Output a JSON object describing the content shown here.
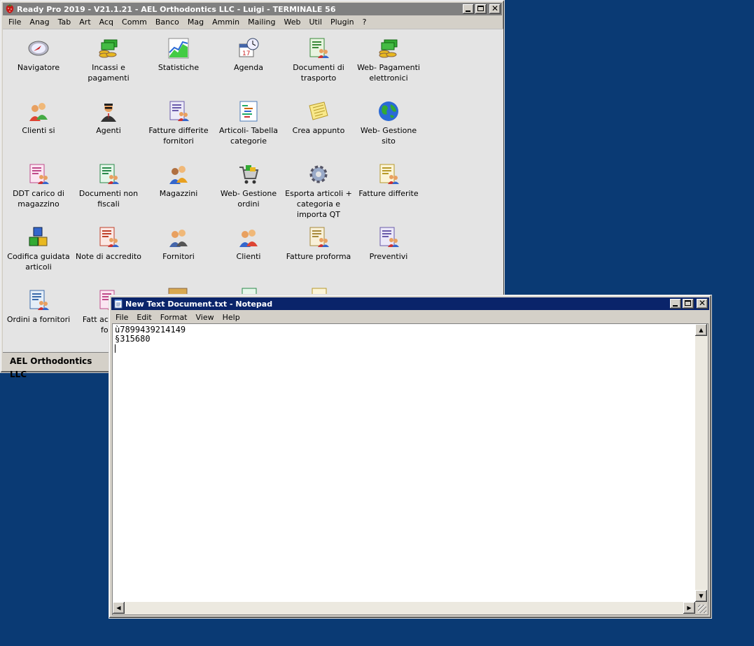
{
  "readypro": {
    "title": "Ready Pro 2019 - V21.1.21 - AEL Orthodontics LLC - Luigi - TERMINALE 56",
    "menu": [
      "File",
      "Anag",
      "Tab",
      "Art",
      "Acq",
      "Comm",
      "Banco",
      "Mag",
      "Ammin",
      "Mailing",
      "Web",
      "Util",
      "Plugin",
      "?"
    ],
    "tiles": [
      {
        "label": "Navigatore",
        "icon": "navigator-icon"
      },
      {
        "label": "Incassi e pagamenti",
        "icon": "money-icon"
      },
      {
        "label": "Statistiche",
        "icon": "chart-icon"
      },
      {
        "label": "Agenda",
        "icon": "calendar-icon"
      },
      {
        "label": "Documenti di trasporto",
        "icon": "document-people-icon"
      },
      {
        "label": "Web- Pagamenti elettronici",
        "icon": "money-icon"
      },
      {
        "label": "Clienti si",
        "icon": "people-icon"
      },
      {
        "label": "Agenti",
        "icon": "agent-icon"
      },
      {
        "label": "Fatture differite fornitori",
        "icon": "document-people-icon"
      },
      {
        "label": "Articoli- Tabella categorie",
        "icon": "list-icon"
      },
      {
        "label": "Crea appunto",
        "icon": "note-icon"
      },
      {
        "label": "Web- Gestione sito",
        "icon": "globe-icon"
      },
      {
        "label": "DDT carico di magazzino",
        "icon": "document-people-icon"
      },
      {
        "label": "Documenti non fiscali",
        "icon": "document-people-icon"
      },
      {
        "label": "Magazzini",
        "icon": "people-icon"
      },
      {
        "label": "Web- Gestione ordini",
        "icon": "cart-icon"
      },
      {
        "label": "Esporta articoli + categoria e importa QT",
        "icon": "gear-icon"
      },
      {
        "label": "Fatture differite",
        "icon": "document-people-icon"
      },
      {
        "label": "Codifica guidata articoli",
        "icon": "cubes-icon"
      },
      {
        "label": "Note di accredito",
        "icon": "document-people-icon"
      },
      {
        "label": "Fornitori",
        "icon": "people-icon"
      },
      {
        "label": "Clienti",
        "icon": "people-icon"
      },
      {
        "label": "Fatture proforma",
        "icon": "document-people-icon"
      },
      {
        "label": "Preventivi",
        "icon": "document-people-icon"
      },
      {
        "label": "Ordini a fornitori",
        "icon": "document-people-icon"
      },
      {
        "label": "Fatt accompa forn",
        "icon": "document-people-icon"
      }
    ],
    "status": "AEL Orthodontics LLC"
  },
  "notepad": {
    "title": "New Text Document.txt - Notepad",
    "menu": [
      "File",
      "Edit",
      "Format",
      "View",
      "Help"
    ],
    "content_lines": [
      "ù7899439214149",
      "§315680"
    ]
  },
  "colors": {
    "desktop": "#0a3a74",
    "active_title": "#0a246a",
    "inactive_title": "#808080"
  }
}
